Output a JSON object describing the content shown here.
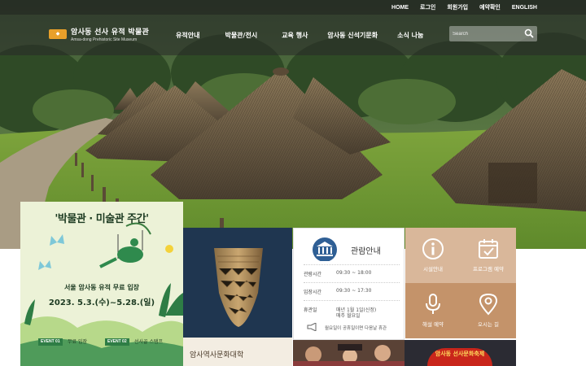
{
  "topbar": {
    "links": [
      "HOME",
      "로그인",
      "회원가입",
      "예약확인",
      "ENGLISH"
    ]
  },
  "header": {
    "logo_title": "암사동 선사 유적 박물관",
    "logo_subtitle": "Amsa-dong Prehistoric Site Museum",
    "menu": [
      "유적안내",
      "박물관/전시",
      "교육 행사",
      "암사동 신석기문화",
      "소식 나눔"
    ],
    "search_placeholder": "Search"
  },
  "event": {
    "title": "'박물관 · 미술관 주간'",
    "subtitle": "서울 암사동 유적 무료 입장",
    "date": "2023. 5.3.(수)~5.28.(일)",
    "event1_badge": "EVENT 01",
    "event1_label": "무료 입장",
    "event2_badge": "EVENT 02",
    "event2_label": "선사골 스탬프"
  },
  "univ": {
    "title": "암사역사문화대학"
  },
  "info": {
    "title": "관람안내",
    "rows": [
      {
        "key": "관람시간",
        "value": "09:30 ~ 18:00"
      },
      {
        "key": "입장시간",
        "value": "09:30 ~ 17:30"
      },
      {
        "key": "휴관일",
        "value": "매년 1월 1일(신정)",
        "value2": "매주 월요일"
      }
    ],
    "note": "월요일이 공휴일이면 다음날 휴관"
  },
  "quick_links": [
    "시설안내",
    "프로그램 예약",
    "해설 예약",
    "오시는 길"
  ],
  "banner": {
    "text": "암사동 선사문화축제"
  },
  "colors": {
    "quick_light": "#d9b79a",
    "quick_dark": "#c4936a",
    "artifact_bg": "#1f3650",
    "event_bg": "#ecf2d7",
    "nav_bg": "#2a2a2a"
  }
}
